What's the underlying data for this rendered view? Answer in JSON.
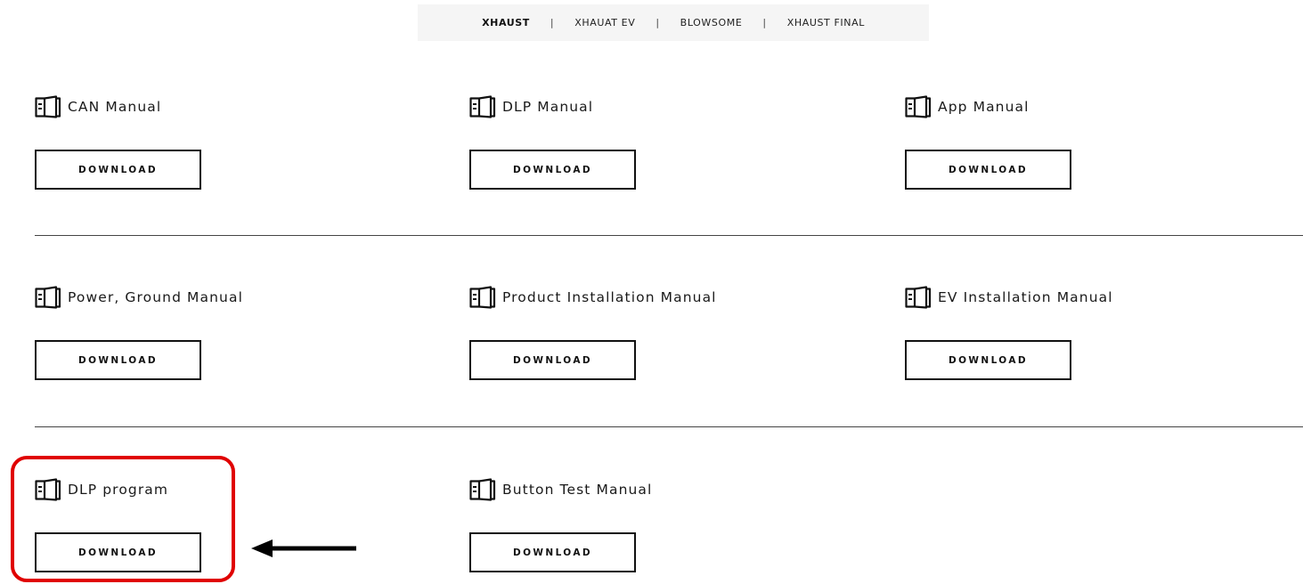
{
  "tabs": [
    {
      "label": "XHAUST",
      "active": true
    },
    {
      "label": "XHAUAT EV",
      "active": false
    },
    {
      "label": "BLOWSOME",
      "active": false
    },
    {
      "label": "XHAUST FINAL",
      "active": false
    }
  ],
  "tab_separator": "|",
  "rows": [
    {
      "items": [
        {
          "title": "CAN Manual",
          "icon": "manual-book-icon",
          "button": "DOWNLOAD"
        },
        {
          "title": "DLP Manual",
          "icon": "manual-book-icon",
          "button": "DOWNLOAD"
        },
        {
          "title": "App Manual",
          "icon": "manual-book-icon",
          "button": "DOWNLOAD"
        }
      ]
    },
    {
      "items": [
        {
          "title": "Power, Ground Manual",
          "icon": "manual-book-icon",
          "button": "DOWNLOAD"
        },
        {
          "title": "Product Installation Manual",
          "icon": "manual-book-icon",
          "button": "DOWNLOAD"
        },
        {
          "title": "EV Installation Manual",
          "icon": "manual-book-icon",
          "button": "DOWNLOAD"
        }
      ]
    },
    {
      "items": [
        {
          "title": "DLP program",
          "icon": "manual-book-icon",
          "button": "DOWNLOAD"
        },
        {
          "title": "Button Test Manual",
          "icon": "manual-book-icon",
          "button": "DOWNLOAD"
        }
      ]
    }
  ],
  "annotation": {
    "highlighted_item": "DLP program",
    "highlight_color": "#e00000",
    "arrow_color": "#000000"
  }
}
